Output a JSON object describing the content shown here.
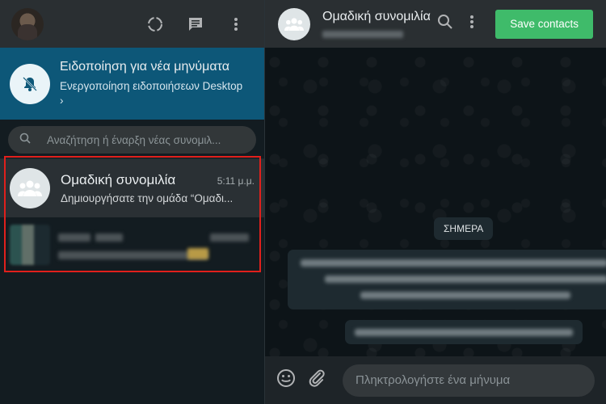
{
  "left_header": {
    "icons": [
      "status-icon",
      "new-chat-icon",
      "menu-icon"
    ]
  },
  "notification": {
    "title": "Ειδοποίηση για νέα μηνύματα",
    "subtitle": "Ενεργοποίηση ειδοποιήσεων Desktop",
    "chevron": "›"
  },
  "search": {
    "placeholder": "Αναζήτηση ή έναρξη νέας συνομιλ..."
  },
  "chats": [
    {
      "name": "Ομαδική συνομιλία",
      "time": "5:11 μ.μ.",
      "preview": "Δημιουργήσατε την ομάδα “Ομαδι..."
    }
  ],
  "conversation": {
    "title": "Ομαδική συνομιλία",
    "save_button": "Save contacts",
    "date_chip": "ΣΗΜΕΡΑ"
  },
  "composer": {
    "placeholder": "Πληκτρολογήστε ένα μήνυμα"
  },
  "colors": {
    "accent_green": "#3fbb6a",
    "notification_bg": "#0d5778",
    "highlight_red": "#e0201c"
  }
}
